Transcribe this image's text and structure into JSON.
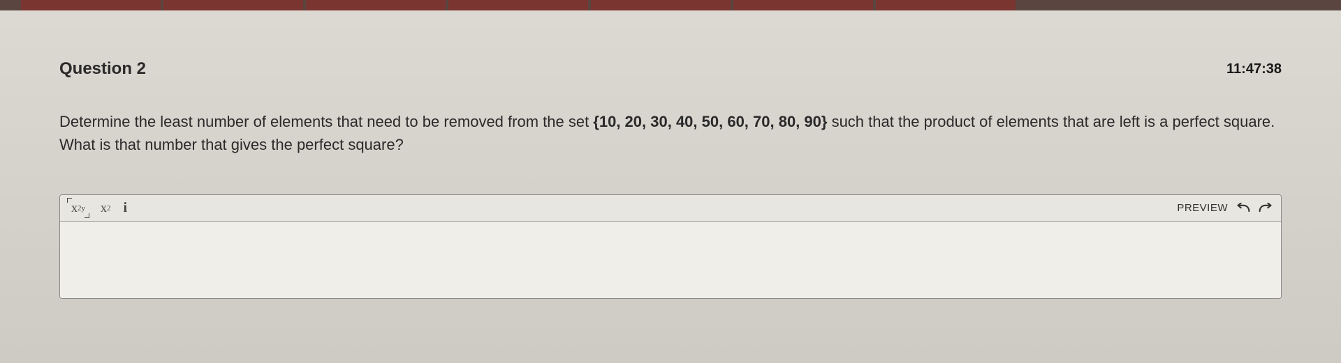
{
  "question": {
    "title": "Question 2",
    "timer": "11:47:38",
    "text_prefix": "Determine the least number of elements that need to be removed from the set ",
    "math_set": "{10, 20, 30, 40, 50, 60, 70, 80, 90}",
    "text_suffix": " such that the product of elements that are left is a perfect square. What is that number that gives the perfect square?"
  },
  "toolbar": {
    "preview_label": "PREVIEW"
  }
}
